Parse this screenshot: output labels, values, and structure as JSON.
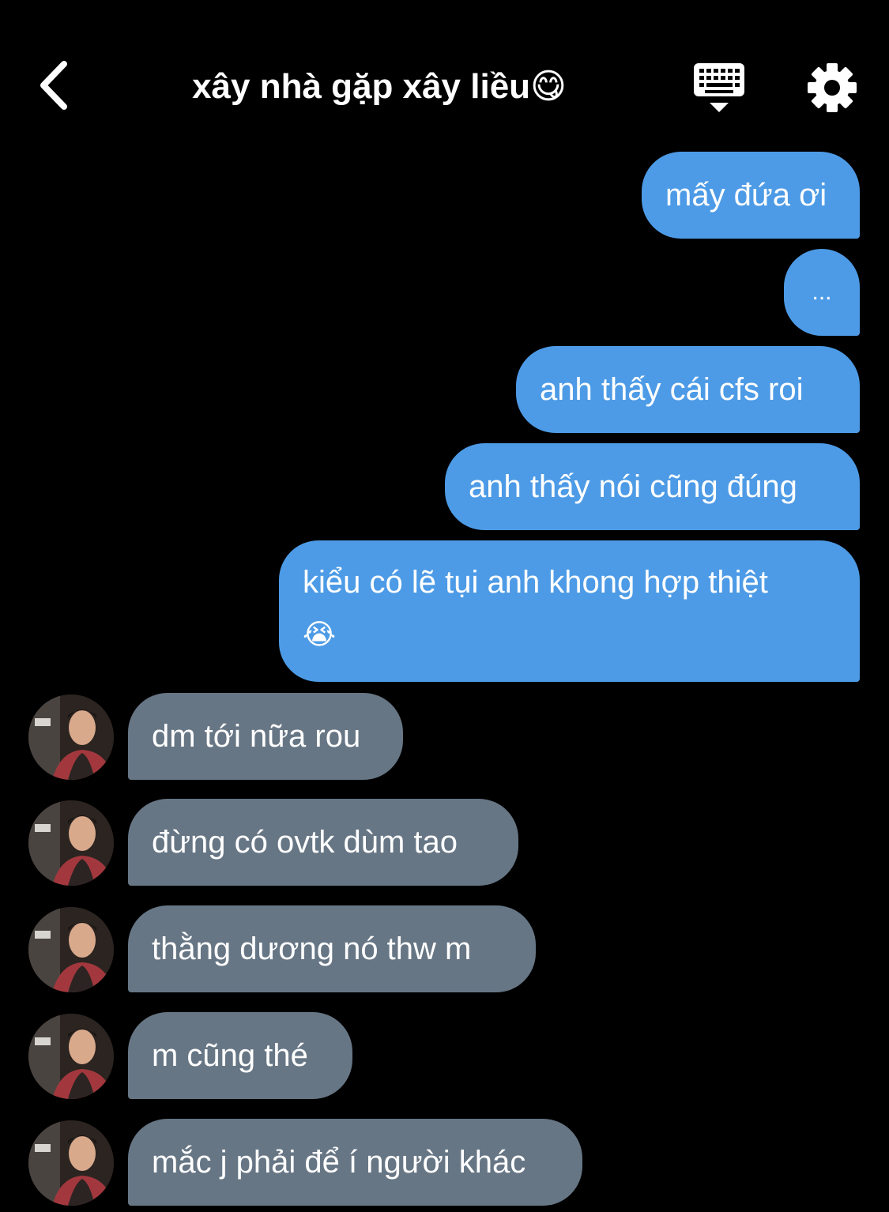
{
  "header": {
    "title": "xây nhà gặp xây liều😋"
  },
  "messages": {
    "outgoing": [
      {
        "text": "mấy đứa ơi"
      },
      {
        "text": "..."
      },
      {
        "text": "anh thấy cái cfs roi"
      },
      {
        "text": "anh thấy nói cũng đúng"
      },
      {
        "line1": "kiểu có lẽ tụi anh khong hợp thiệt",
        "line2": "😭"
      }
    ],
    "incoming": [
      {
        "text": "dm tới nữa rou"
      },
      {
        "text": "đừng có ovtk dùm tao"
      },
      {
        "text": "thằng dương nó thw m"
      },
      {
        "text": "m cũng thé"
      },
      {
        "text": "mắc j phải để í người khác"
      }
    ]
  },
  "colors": {
    "background": "#000000",
    "outgoing_bubble": "#4d9be6",
    "incoming_bubble": "#677685",
    "text": "#ffffff"
  },
  "icons": {
    "back": "chevron-left-icon",
    "keyboard": "keyboard-dismiss-icon",
    "settings": "gear-icon"
  }
}
